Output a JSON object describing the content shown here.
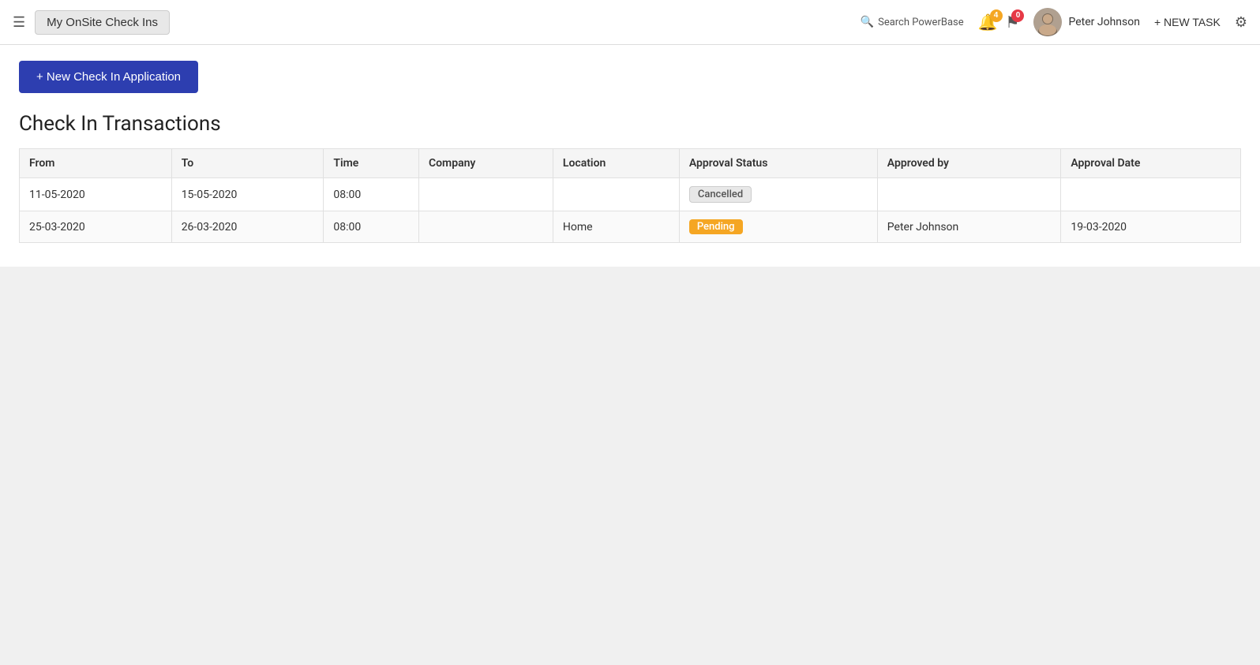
{
  "topnav": {
    "app_title": "My OnSite Check Ins",
    "search_label": "Search PowerBase",
    "notifications_count": "4",
    "messages_count": "0",
    "username": "Peter Johnson",
    "new_task_label": "+ NEW TASK"
  },
  "main": {
    "new_checkin_button": "+ New Check In Application",
    "section_title": "Check In Transactions",
    "table": {
      "headers": [
        "From",
        "To",
        "Time",
        "Company",
        "Location",
        "Approval Status",
        "Approved by",
        "Approval Date"
      ],
      "rows": [
        {
          "from": "11-05-2020",
          "to": "15-05-2020",
          "time": "08:00",
          "company": "",
          "location": "",
          "approval_status": "Cancelled",
          "approval_status_type": "cancelled",
          "approved_by": "",
          "approval_date": ""
        },
        {
          "from": "25-03-2020",
          "to": "26-03-2020",
          "time": "08:00",
          "company": "",
          "location": "Home",
          "approval_status": "Pending",
          "approval_status_type": "pending",
          "approved_by": "Peter Johnson",
          "approval_date": "19-03-2020"
        }
      ]
    }
  }
}
